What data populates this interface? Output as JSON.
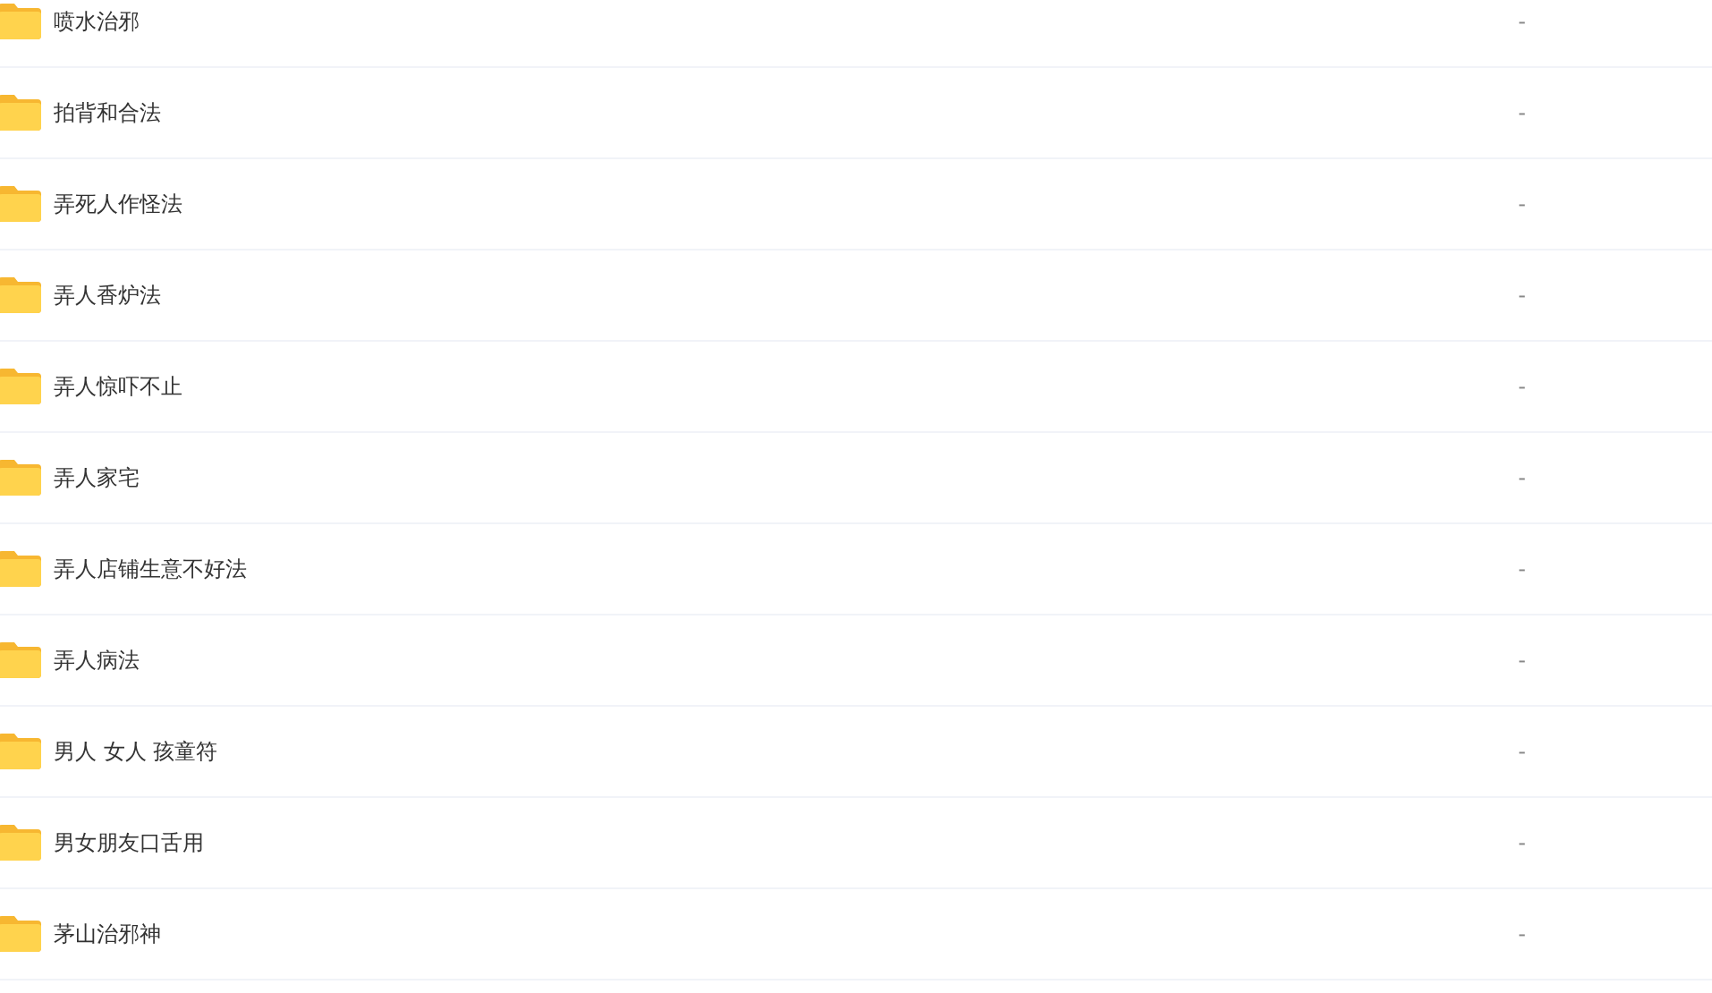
{
  "files": [
    {
      "name": "喷水治邪",
      "size": "-"
    },
    {
      "name": "拍背和合法",
      "size": "-"
    },
    {
      "name": "弄死人作怪法",
      "size": "-"
    },
    {
      "name": "弄人香炉法",
      "size": "-"
    },
    {
      "name": "弄人惊吓不止",
      "size": "-"
    },
    {
      "name": "弄人家宅",
      "size": "-"
    },
    {
      "name": "弄人店铺生意不好法",
      "size": "-"
    },
    {
      "name": "弄人病法",
      "size": "-"
    },
    {
      "name": "男人 女人 孩童符",
      "size": "-"
    },
    {
      "name": "男女朋友口舌用",
      "size": "-"
    },
    {
      "name": "茅山治邪神",
      "size": "-"
    }
  ]
}
